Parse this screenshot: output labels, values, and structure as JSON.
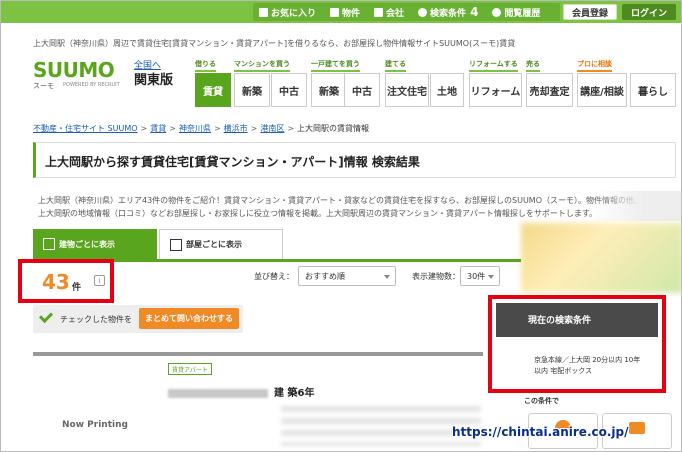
{
  "topbar": {
    "nav": [
      {
        "label": "お気に入り",
        "icon": "heart-icon"
      },
      {
        "label": "物件",
        "icon": "house-icon"
      },
      {
        "label": "会社",
        "icon": "building-icon"
      },
      {
        "label": "検索条件",
        "icon": "search-icon",
        "count": "4"
      },
      {
        "label": "閲覧履歴",
        "icon": "clock-icon"
      }
    ],
    "register_label": "会員登録",
    "login_label": "ログイン"
  },
  "tagline": "上大岡駅（神奈川県）周辺で賃貸住宅[賃貸マンション・賃貸アパート]を借りるなら、お部屋探し物件情報サイトSUUMO(スーモ)賃貸",
  "logo": {
    "text": "SUUMO",
    "sub": "スーモ",
    "by": "POWERED BY RECRUIT"
  },
  "region": {
    "link": "全国へ",
    "name": "関東版"
  },
  "categories": [
    {
      "label": "借りる",
      "style": "green"
    },
    {
      "label": "マンションを買う",
      "style": "green"
    },
    {
      "label": "一戸建てを買う",
      "style": "green"
    },
    {
      "label": "建てる",
      "style": "green"
    },
    {
      "label": "リフォームする",
      "style": "green"
    },
    {
      "label": "売る",
      "style": "green"
    },
    {
      "label": "プロに相談",
      "style": "orange"
    }
  ],
  "nav_buttons": [
    "賃貸",
    "新築",
    "中古",
    "新築",
    "中古",
    "注文住宅",
    "土地",
    "リフォーム",
    "売却査定",
    "講座/相談",
    "暮らし"
  ],
  "breadcrumb": {
    "links": [
      "不動産・住宅サイト SUUMO",
      "賃貸",
      "神奈川県",
      "横浜市",
      "港南区"
    ],
    "current": "上大岡駅の賃貸情報"
  },
  "page_title": "上大岡駅から探す賃貸住宅[賃貸マンション・アパート]情報 検索結果",
  "description": [
    "上大岡駅（神奈川県）エリア43件の物件をご紹介！賃貸マンション・賃貸アパート・貸家などの賃貸住宅を探すなら、お部屋探しのSUUMO（スーモ）。物件情報の他、",
    "上大岡駅の地域情報（口コミ）などお部屋探し・お家探しに役立つ情報を掲載。上大岡駅周辺の賃貸マンション・賃貸アパート情報探しをサポートします。"
  ],
  "tabs": [
    {
      "label": "建物ごとに表示",
      "active": true
    },
    {
      "label": "部屋ごとに表示",
      "active": false
    }
  ],
  "results": {
    "count": "43",
    "unit": "件",
    "info": "i"
  },
  "sort": {
    "label": "並び替え：",
    "value": "おすすめ順"
  },
  "display": {
    "label": "表示建物数：",
    "value": "30件"
  },
  "inquiry": {
    "label": "チェックした物件を",
    "button": "まとめて問い合わせする"
  },
  "listing": {
    "tag": "賃貸アパート",
    "title_suffix": "建 築6年",
    "image_placeholder": "Now Printing"
  },
  "search_conditions": {
    "header": "現在の検索条件",
    "lines": [
      "京急本線／上大岡 20分以内 10年",
      "以内 宅配ボックス"
    ],
    "more": "この条件で"
  },
  "watermark": "https://chintai.anire.co.jp/",
  "colors": {
    "brand_green": "#5aa51e",
    "top_green": "#7cc243",
    "accent_orange": "#f08a24",
    "highlight_red": "#e60012",
    "link_blue": "#1a5eb5"
  }
}
